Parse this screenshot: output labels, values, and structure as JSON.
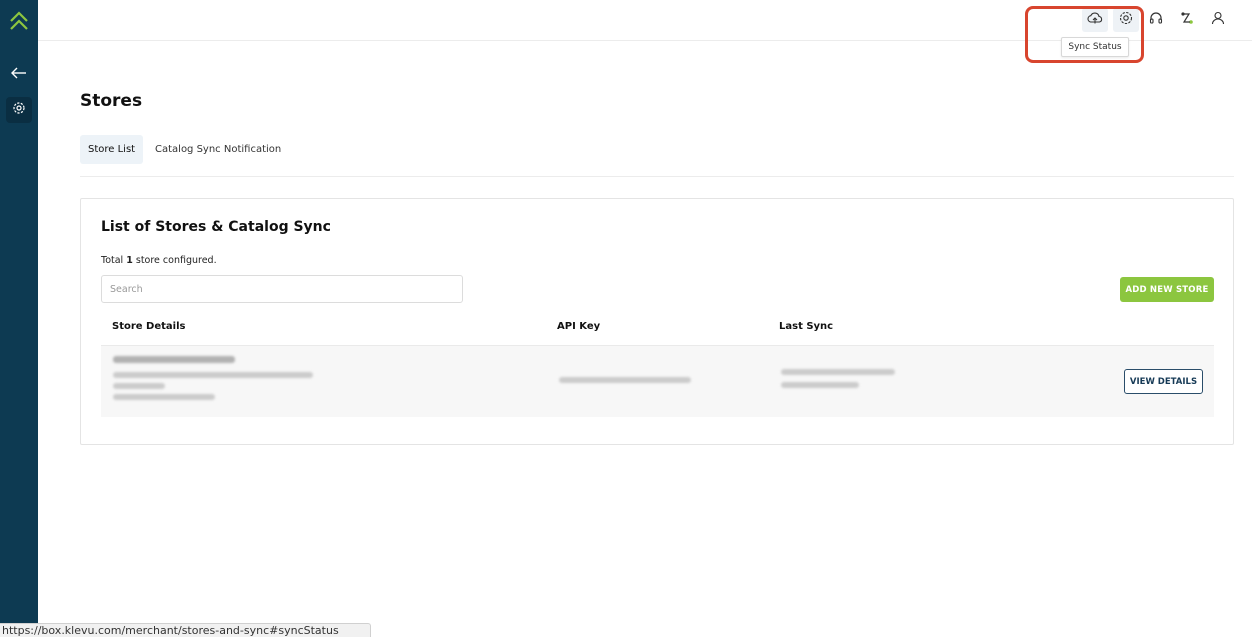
{
  "header": {
    "tooltip": "Sync Status",
    "icons": [
      "sync-status-cloud-icon",
      "settings-gear-icon",
      "headset-support-icon",
      "integrations-icon",
      "user-profile-icon"
    ]
  },
  "sidebar": {
    "icons": [
      "logo-icon",
      "back-arrow-icon",
      "settings-gear-icon"
    ]
  },
  "page": {
    "title": "Stores",
    "tabs": [
      {
        "label": "Store List",
        "active": true
      },
      {
        "label": "Catalog Sync Notification",
        "active": false
      }
    ]
  },
  "card": {
    "title": "List of Stores & Catalog Sync",
    "total_prefix": "Total ",
    "total_count": "1",
    "total_suffix": " store configured.",
    "search_placeholder": "Search",
    "add_button": "ADD NEW STORE",
    "columns": [
      "Store Details",
      "API Key",
      "Last Sync"
    ],
    "view_button": "VIEW DETAILS"
  },
  "statusbar": {
    "url": "https://box.klevu.com/merchant/stores-and-sync#syncStatus"
  },
  "colors": {
    "sidebar": "#0d3a52",
    "accent_green": "#8cc63f",
    "highlight": "#d8452e"
  }
}
